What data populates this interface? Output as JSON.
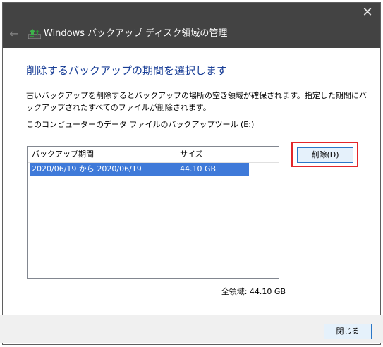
{
  "window": {
    "title": "Windows バックアップ ディスク領域の管理",
    "close_glyph": "✕",
    "back_glyph": "←"
  },
  "content": {
    "heading": "削除するバックアップの期間を選択します",
    "description": "古いバックアップを削除するとバックアップの場所の空き領域が確保されます。指定した期間にバックアップされたすべてのファイルが削除されます。",
    "drive_label": "このコンピューターのデータ ファイルのバックアップツール (E:)"
  },
  "list": {
    "headers": [
      "バックアップ期間",
      "サイズ"
    ],
    "rows": [
      {
        "period": "2020/06/19 から 2020/06/19",
        "size": "44.10 GB",
        "selected": true
      }
    ]
  },
  "buttons": {
    "delete_label": "削除(D)",
    "close_label": "閉じる"
  },
  "total": "全領域: 44.10 GB",
  "colors": {
    "titlebar": "#434343",
    "heading": "#1a3f97",
    "selection": "#3f7ad9",
    "highlight": "#e2262a"
  },
  "icons": {
    "app": "windows-backup-icon"
  }
}
